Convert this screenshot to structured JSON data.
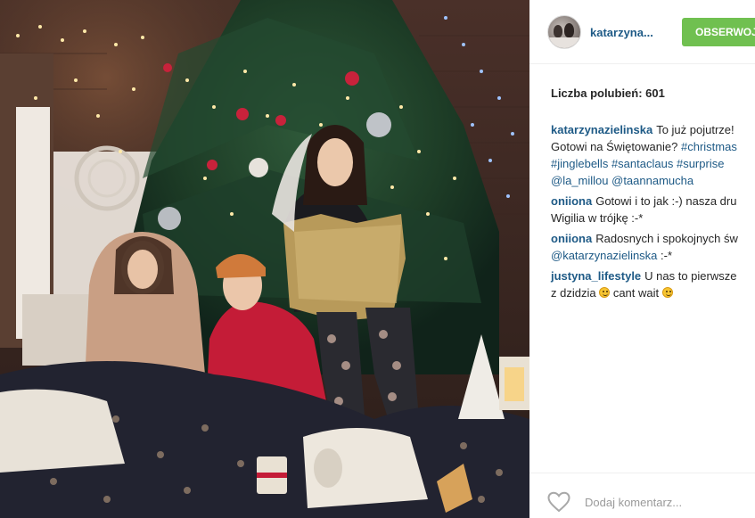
{
  "post": {
    "photo_alt": "",
    "username": "katarzyna...",
    "follow_label": "OBSERWOJ",
    "likes_text": "Liczba polubień: 601"
  },
  "comments": [
    {
      "user": "katarzynazielinska",
      "lines": [
        [
          {
            "t": "To już pojutrze! "
          }
        ],
        [
          {
            "t": "Gotowi na Świętowanie? "
          },
          {
            "t": "#christmas",
            "tag": true
          }
        ],
        [
          {
            "t": "#jinglebells",
            "tag": true
          },
          {
            "t": " "
          },
          {
            "t": "#santaclaus",
            "tag": true
          },
          {
            "t": " "
          },
          {
            "t": "#surprise",
            "tag": true
          }
        ],
        [
          {
            "t": "@la_millou",
            "tag": true
          },
          {
            "t": " "
          },
          {
            "t": "@taannamucha",
            "tag": true
          }
        ]
      ]
    },
    {
      "user": "oniiona",
      "lines": [
        [
          {
            "t": "Gotowi i to jak :-) nasza dru"
          }
        ],
        [
          {
            "t": "Wigilia w trójkę :-*"
          }
        ]
      ]
    },
    {
      "user": "oniiona",
      "lines": [
        [
          {
            "t": "Radosnych i spokojnych św"
          }
        ],
        [
          {
            "t": "@katarzynazielinska",
            "tag": true
          },
          {
            "t": " :-*"
          }
        ]
      ]
    },
    {
      "user": "justyna_lifestyle",
      "lines": [
        [
          {
            "t": "U nas to pierwsze"
          }
        ],
        [
          {
            "t": "z dzidzia "
          },
          {
            "emoji": "smile-emoji"
          },
          {
            "t": " cant wait "
          },
          {
            "emoji": "laugh-emoji"
          }
        ]
      ]
    }
  ],
  "footer": {
    "like_icon": "heart-outline-icon",
    "comment_placeholder": "Dodaj komentarz..."
  },
  "colors": {
    "follow_green": "#70c050",
    "link_blue": "#1e5a86",
    "text": "#262626"
  }
}
